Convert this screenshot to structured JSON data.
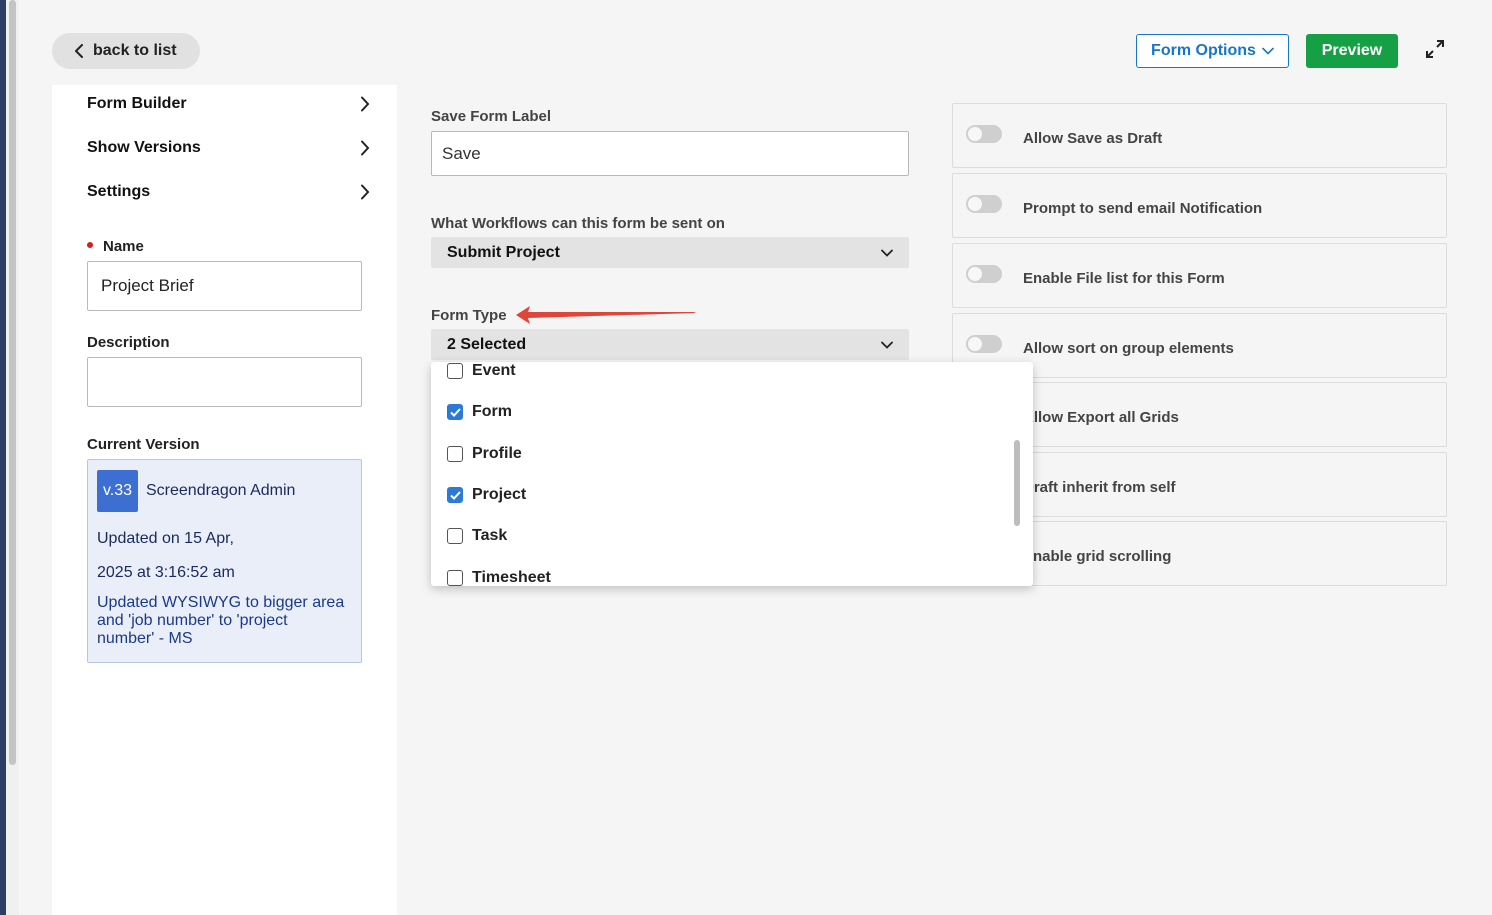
{
  "header": {
    "back_label": "back to list",
    "form_options_label": "Form Options",
    "preview_label": "Preview"
  },
  "sidebar": {
    "nav": [
      {
        "label": "Form Builder"
      },
      {
        "label": "Show Versions"
      },
      {
        "label": "Settings"
      }
    ],
    "name_label": "Name",
    "name_value": "Project Brief",
    "description_label": "Description",
    "description_value": "",
    "current_version_label": "Current Version",
    "version": {
      "badge": "v.33",
      "author": "Screendragon Admin",
      "updated_line1": "Updated on 15 Apr,",
      "updated_line2": "2025 at 3:16:52 am",
      "comment": "Updated WYSIWYG to bigger area and 'job number' to 'project number' - MS"
    }
  },
  "main": {
    "save_form_label": "Save Form Label",
    "save_form_value": "Save",
    "workflows_label": "What Workflows can this form be sent on",
    "workflows_selected": "Submit Project",
    "form_type_label": "Form Type",
    "form_type_selected": "2 Selected",
    "form_type_options": [
      {
        "label": "Event",
        "checked": false
      },
      {
        "label": "Form",
        "checked": true
      },
      {
        "label": "Profile",
        "checked": false
      },
      {
        "label": "Project",
        "checked": true
      },
      {
        "label": "Task",
        "checked": false
      },
      {
        "label": "Timesheet",
        "checked": false
      }
    ]
  },
  "settings_toggles": [
    {
      "label": "Allow Save as Draft",
      "on": false
    },
    {
      "label": "Prompt to send email Notification",
      "on": false
    },
    {
      "label": "Enable File list for this Form",
      "on": false
    },
    {
      "label": "Allow sort on group elements",
      "on": false
    },
    {
      "label": "Allow Export all Grids",
      "on": false
    },
    {
      "label": "Draft inherit from self",
      "on": false
    },
    {
      "label": "Enable grid scrolling",
      "on": false
    }
  ],
  "colors": {
    "accent_blue": "#1677c9",
    "preview_green": "#15a045",
    "checkbox_blue": "#2a7ad6",
    "annotation_red": "#e0453a",
    "version_card_bg": "#e9eef9"
  }
}
